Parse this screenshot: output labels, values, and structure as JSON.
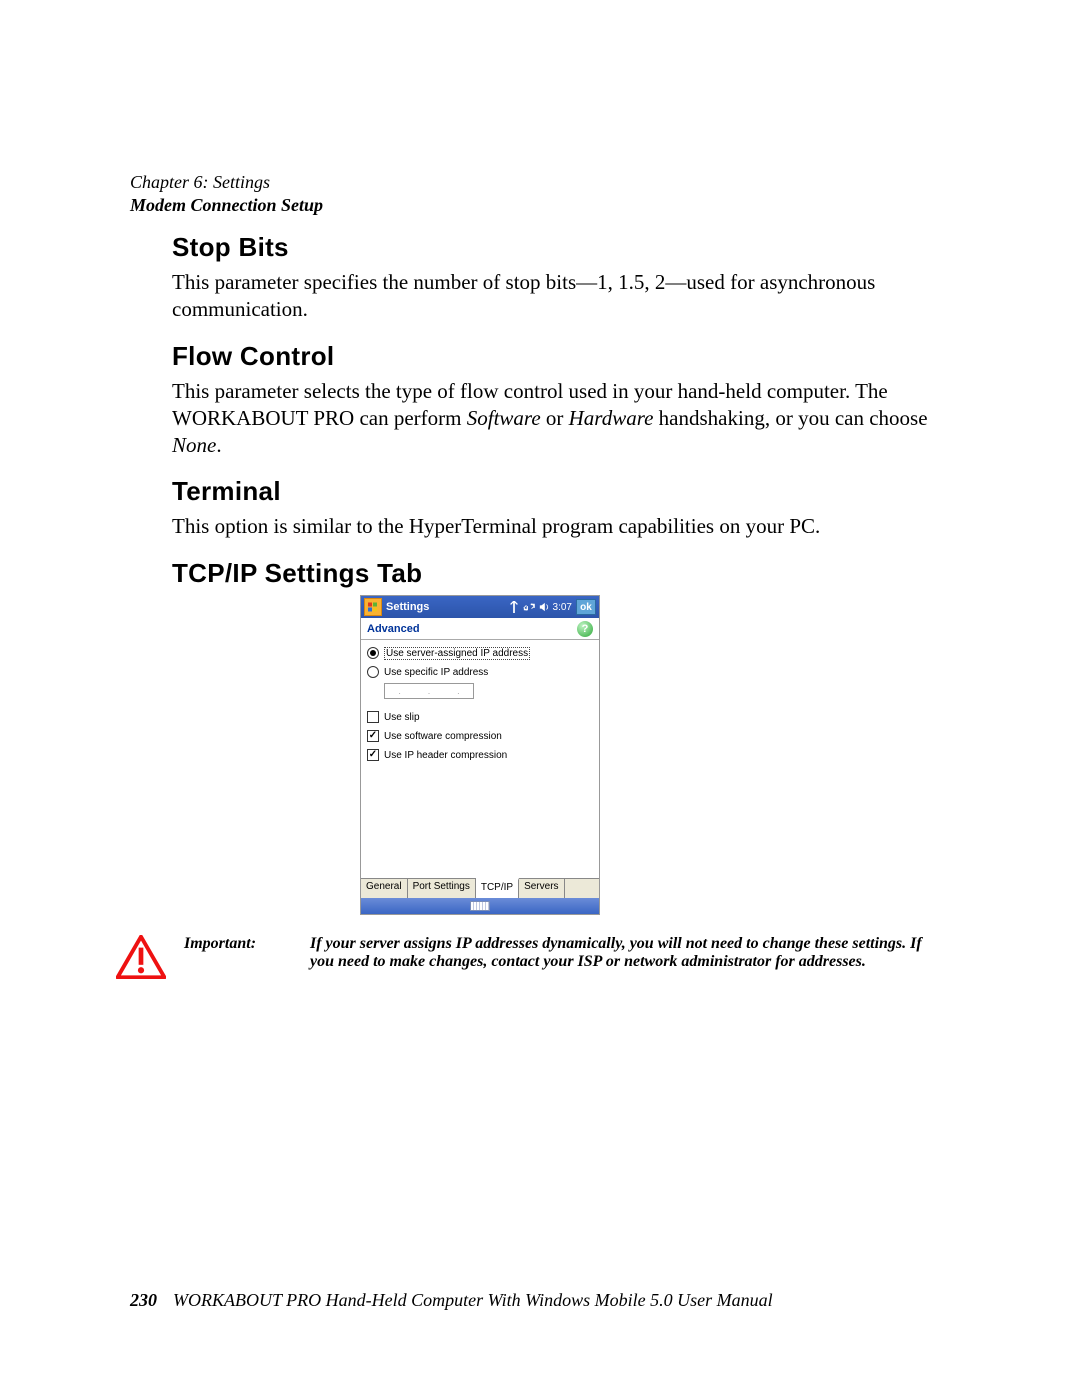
{
  "header": {
    "chapter": "Chapter 6:  Settings",
    "section": "Modem Connection Setup"
  },
  "sections": {
    "stop_bits": {
      "title": "Stop Bits",
      "body": "This parameter specifies the number of stop bits—1, 1.5, 2—used for asynchronous communication."
    },
    "flow_control": {
      "title": "Flow Control",
      "body_pre": "This parameter selects the type of flow control used in your hand-held computer. The WORKABOUT PRO can perform ",
      "sw": "Software",
      "mid1": " or ",
      "hw": "Hardware",
      "mid2": " handshaking, or you can choose ",
      "none": "None",
      "tail": "."
    },
    "terminal": {
      "title": "Terminal",
      "body": "This option is similar to the HyperTerminal program capabilities on your PC."
    },
    "tcpip": {
      "title": "TCP/IP Settings Tab"
    }
  },
  "screenshot": {
    "titlebar": {
      "app": "Settings",
      "time": "3:07",
      "ok": "ok"
    },
    "subtitle": "Advanced",
    "help": "?",
    "options": {
      "radio1": "Use server-assigned IP address",
      "radio2": "Use specific IP address",
      "check1": "Use slip",
      "check2": "Use software compression",
      "check3": "Use IP header compression"
    },
    "tabs": [
      "General",
      "Port Settings",
      "TCP/IP",
      "Servers"
    ]
  },
  "important": {
    "label": "Important:",
    "body": "If your server assigns IP addresses dynamically, you will not need to change these settings. If you need to make changes, contact your ISP or network administrator for addresses."
  },
  "footer": {
    "page": "230",
    "doc": "WORKABOUT PRO Hand-Held Computer With Windows Mobile 5.0 User Manual"
  }
}
